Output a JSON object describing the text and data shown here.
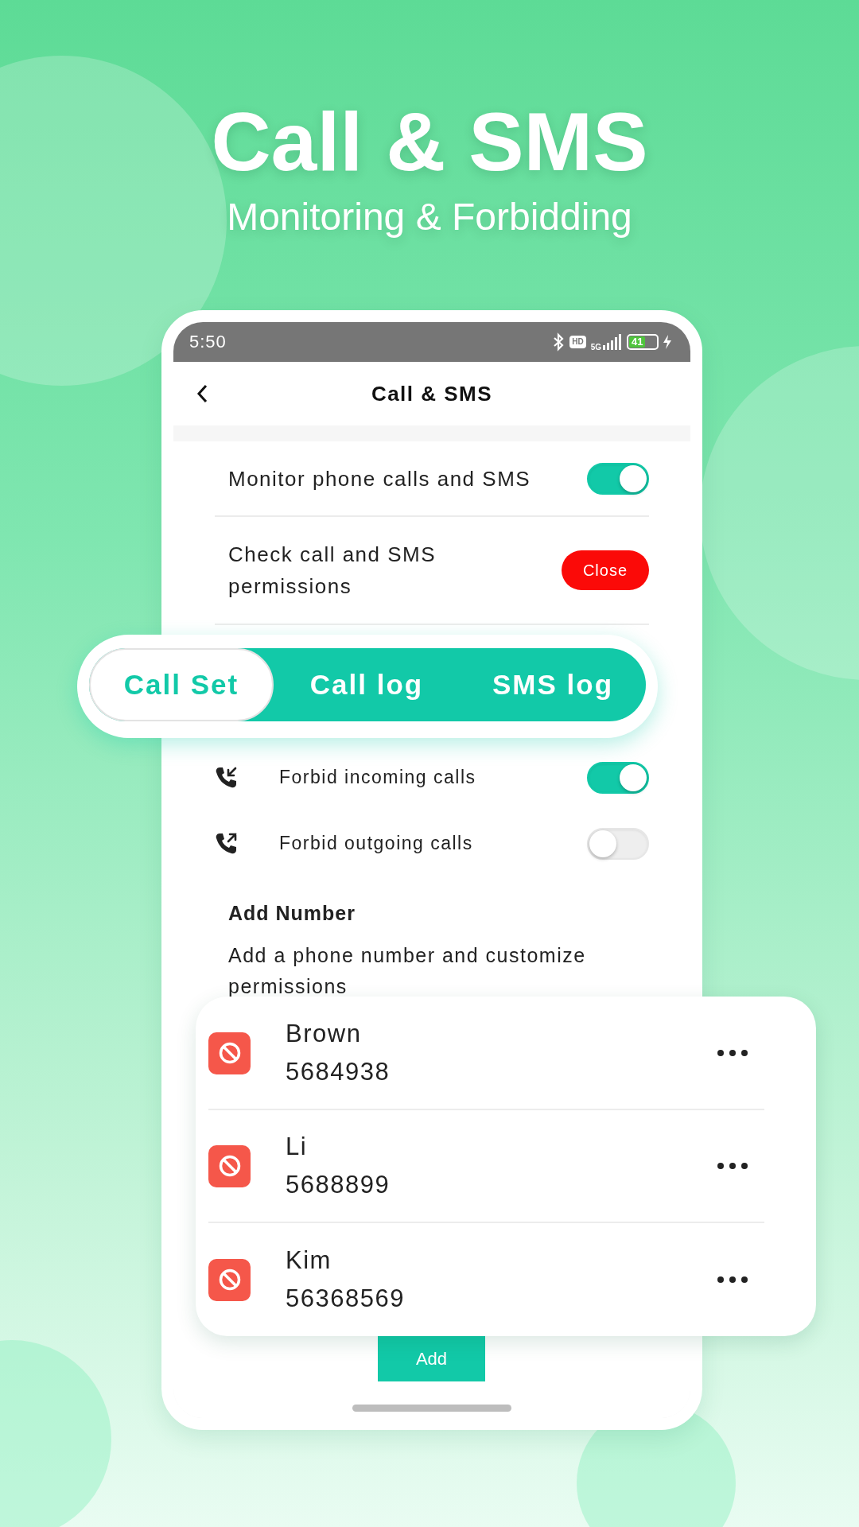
{
  "headline": {
    "title": "Call & SMS",
    "subtitle": "Monitoring & Forbidding"
  },
  "status_bar": {
    "time": "5:50",
    "hd": "HD",
    "network": "5G",
    "battery": "41"
  },
  "app_bar": {
    "title": "Call & SMS"
  },
  "settings": [
    {
      "kind": "toggle",
      "label": "Monitor phone calls and SMS",
      "on": true
    },
    {
      "kind": "button",
      "label": "Check call and SMS permissions",
      "button": "Close"
    }
  ],
  "tabs": [
    {
      "label": "Call Set",
      "selected": true
    },
    {
      "label": "Call log",
      "selected": false
    },
    {
      "label": "SMS log",
      "selected": false
    }
  ],
  "forbid": [
    {
      "kind": "incoming",
      "label": "Forbid incoming calls",
      "on": true
    },
    {
      "kind": "outgoing",
      "label": "Forbid outgoing calls",
      "on": false
    }
  ],
  "add_number": {
    "title": "Add Number",
    "description": "Add a phone number and customize permissions"
  },
  "contacts": [
    {
      "name": "Brown",
      "number": "5684938"
    },
    {
      "name": "Li",
      "number": "5688899"
    },
    {
      "name": "Kim",
      "number": "56368569"
    }
  ],
  "add_button": "Add"
}
